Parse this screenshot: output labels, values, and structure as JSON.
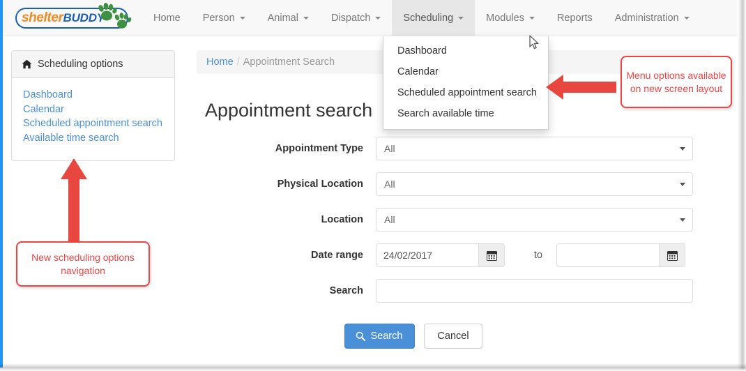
{
  "brand": {
    "name_part1": "shelter",
    "name_part2": "BUDDY",
    "logo_color_orange": "#f08a24",
    "logo_color_blue": "#1a5fb4",
    "paw_color": "#3f9142"
  },
  "navbar": {
    "items": [
      {
        "label": "Home",
        "has_caret": false,
        "active": false
      },
      {
        "label": "Person",
        "has_caret": true,
        "active": false
      },
      {
        "label": "Animal",
        "has_caret": true,
        "active": false
      },
      {
        "label": "Dispatch",
        "has_caret": true,
        "active": false
      },
      {
        "label": "Scheduling",
        "has_caret": true,
        "active": true
      },
      {
        "label": "Modules",
        "has_caret": true,
        "active": false
      },
      {
        "label": "Reports",
        "has_caret": false,
        "active": false
      },
      {
        "label": "Administration",
        "has_caret": true,
        "active": false
      }
    ]
  },
  "dropdown": {
    "owner": "Scheduling",
    "items": [
      "Dashboard",
      "Calendar",
      "Scheduled appointment search",
      "Search available time"
    ]
  },
  "sidebar": {
    "title": "Scheduling options",
    "icon": "home-icon",
    "links": [
      "Dashboard",
      "Calendar",
      "Scheduled appointment search",
      "Available time search"
    ]
  },
  "breadcrumb": {
    "home": "Home",
    "separator": "/",
    "current": "Appointment Search"
  },
  "page": {
    "title": "Appointment search"
  },
  "form": {
    "rows": [
      {
        "label": "Appointment Type",
        "type": "select",
        "value": "All"
      },
      {
        "label": "Physical Location",
        "type": "select",
        "value": "All"
      },
      {
        "label": "Location",
        "type": "select",
        "value": "All"
      }
    ],
    "date_range": {
      "label": "Date range",
      "from_value": "24/02/2017",
      "from_placeholder": "",
      "to_word": "to",
      "to_value": "",
      "to_placeholder": "",
      "calendar_icon": "calendar-icon"
    },
    "search_field": {
      "label": "Search",
      "value": "",
      "placeholder": ""
    },
    "buttons": {
      "search": "Search",
      "search_icon": "magnifier-icon",
      "cancel": "Cancel",
      "primary_color": "#4a90d9"
    }
  },
  "annotations": {
    "color": "#ef4444",
    "menu_note": "Menu options available on new screen layout",
    "nav_note": "New scheduling options navigation"
  }
}
